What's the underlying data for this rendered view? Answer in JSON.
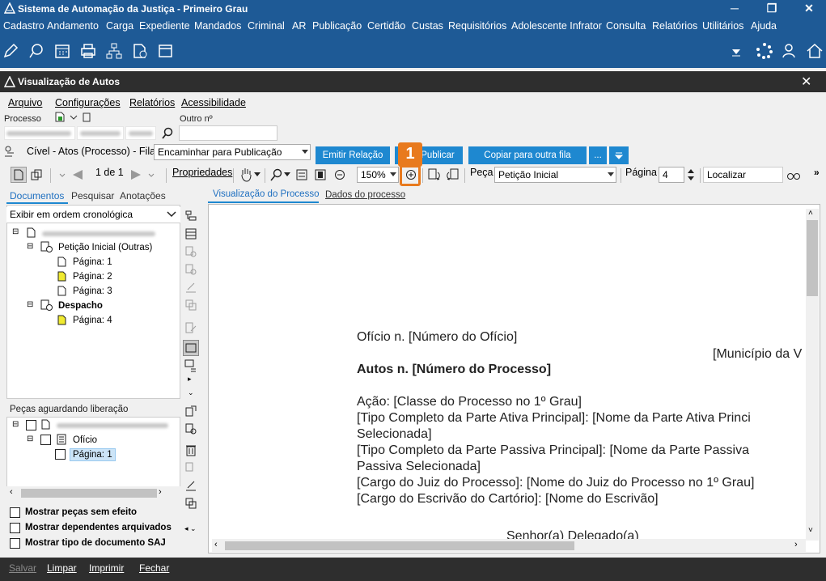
{
  "app": {
    "title": "Sistema de Automação da Justiça - Primeiro Grau",
    "window_controls": [
      "─",
      "❐",
      "✕"
    ]
  },
  "menu": [
    "Cadastro",
    "Andamento",
    "Carga",
    "Expediente",
    "Mandados",
    "Criminal",
    "AR",
    "Publicação",
    "Certidão",
    "Custas",
    "Requisitórios",
    "Adolescente Infrator",
    "Consulta",
    "Relatórios",
    "Utilitários",
    "Ajuda"
  ],
  "window": {
    "title": "Visualização de Autos",
    "close": "✕"
  },
  "submenu": [
    "Arquivo",
    "Configurações",
    "Relatórios",
    "Acessibilidade"
  ],
  "process": {
    "processo_label": "Processo",
    "outro_label": "Outro nº",
    "search_icon": "search-icon",
    "class_text": "Cível - Atos (Processo) - Fila:",
    "fila_value": "Encaminhar para Publicação",
    "buttons": {
      "emitir": "Emitir Relação",
      "publicar": "Publicar",
      "copiar": "Copiar para outra fila",
      "more": "..."
    }
  },
  "viewer_toolbar": {
    "page_indicator": "1 de 1",
    "propriedades": "Propriedades",
    "zoom": "150%",
    "peca_label": "Peça",
    "peca_value": "Petição Inicial",
    "pagina_label": "Página",
    "pagina_value": "4",
    "localizar_placeholder": "Localizar"
  },
  "left_tabs": [
    "Documentos",
    "Pesquisar",
    "Anotações"
  ],
  "order_select": "Exibir em ordem cronológica",
  "tree": {
    "peticao": "Petição Inicial (Outras)",
    "pages": [
      "Página: 1",
      "Página: 2",
      "Página: 3"
    ],
    "despacho": "Despacho",
    "despacho_page": "Página: 4"
  },
  "pending": {
    "title": "Peças aguardando liberação",
    "oficio": "Ofício",
    "page": "Página: 1"
  },
  "checkboxes": [
    "Mostrar peças sem efeito",
    "Mostrar dependentes arquivados",
    "Mostrar tipo de documento SAJ"
  ],
  "viewer_tabs": [
    "Visualização do Processo",
    "Dados do processo"
  ],
  "document": {
    "line1": "Ofício n. [Número do Ofício]",
    "line2": "[Município da V",
    "line3": "Autos n. [Número do Processo]",
    "line4": "Ação: [Classe do Processo no 1º Grau]",
    "line5": "[Tipo Completo da Parte Ativa Principal]: [Nome da Parte Ativa Princi",
    "line6": "Selecionada]",
    "line7": "[Tipo Completo da Parte Passiva Principal]: [Nome da Parte Passiva",
    "line8": "Passiva Selecionada]",
    "line9": "[Cargo do Juiz do Processo]: [Nome do Juiz do Processo no 1º Grau]",
    "line10": "[Cargo do Escrivão do Cartório]: [Nome do Escrivão]",
    "line11": "Senhor(a) Delegado(a)"
  },
  "callout": "1",
  "bottom": [
    "Salvar",
    "Limpar",
    "Imprimir",
    "Fechar"
  ],
  "colors": {
    "titlebar": "#1e5a96",
    "dark": "#2e2e2e",
    "accent": "#1e88d0",
    "callout": "#e87a1e"
  }
}
